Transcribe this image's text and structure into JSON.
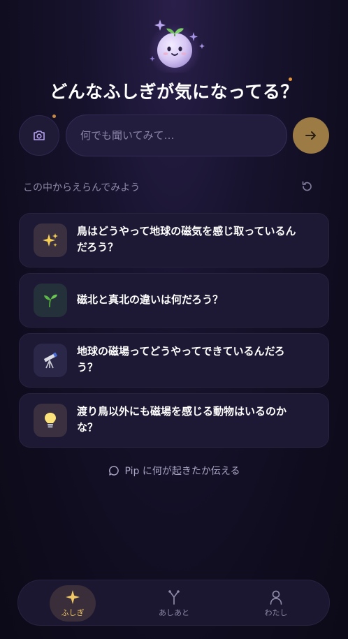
{
  "title": "どんなふしぎが気になってる？",
  "search": {
    "placeholder": "何でも聞いてみて…",
    "value": ""
  },
  "section_label": "この中からえらんでみよう",
  "suggestions": [
    {
      "icon": "sparkles-icon",
      "emoji": "✨",
      "line1": "鳥はどうやって地球の磁気を感じ取っているん",
      "line2": "だろう？"
    },
    {
      "icon": "seedling-icon",
      "emoji": "🌱",
      "line1": "磁北と真北の違いは何だろう？",
      "line2": ""
    },
    {
      "icon": "telescope-icon",
      "emoji": "🔭",
      "line1": "地球の磁場ってどうやってできているんだろ",
      "line2": "う？"
    },
    {
      "icon": "light-bulb-icon",
      "emoji": "💡",
      "line1": "渡り鳥以外にも磁場を感じる動物はいるのか",
      "line2": "な？"
    }
  ],
  "feedback_link": "Pip に何が起きたか伝える",
  "nav": [
    {
      "label": "ふしぎ",
      "icon": "sparkle-icon",
      "active": true
    },
    {
      "label": "あしあと",
      "icon": "footprint-branch-icon",
      "active": false
    },
    {
      "label": "わたし",
      "icon": "person-icon",
      "active": false
    }
  ],
  "colors": {
    "accent_gold": "#f0c766",
    "send_button": "#9c7b45",
    "notification_dot": "#e8943a",
    "mascot": "#d9cdf5"
  }
}
